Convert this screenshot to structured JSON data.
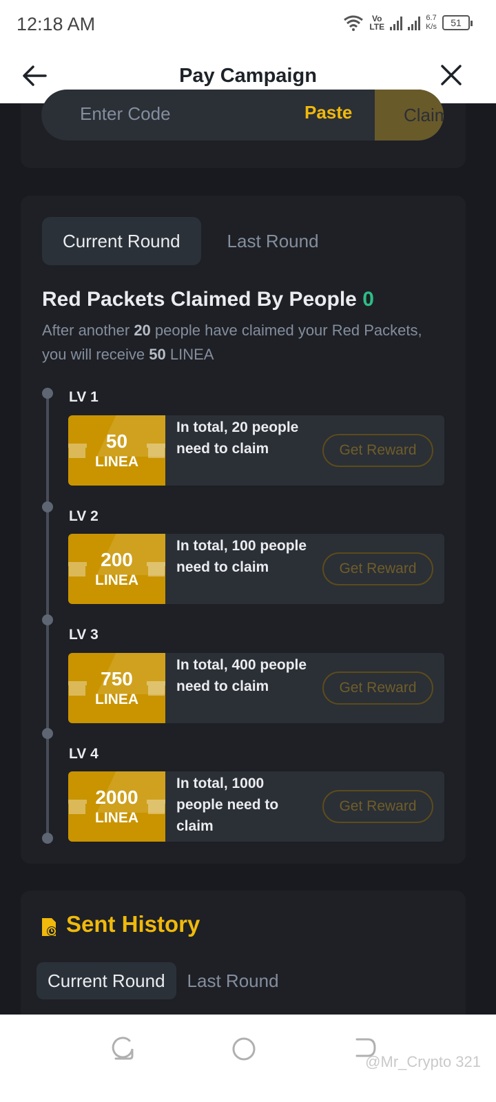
{
  "status_bar": {
    "time": "12:18 AM",
    "volte_top": "Vo",
    "volte_bottom": "LTE",
    "net_speed_value": "6.7",
    "net_speed_unit": "K/s",
    "battery": "51"
  },
  "header": {
    "title": "Pay Campaign",
    "back_icon": "arrow-left-icon",
    "close_icon": "close-icon"
  },
  "code_entry": {
    "placeholder": "Enter Code",
    "paste_label": "Paste",
    "claim_label": "Claim"
  },
  "round_tabs": [
    {
      "label": "Current Round",
      "active": true
    },
    {
      "label": "Last Round",
      "active": false
    }
  ],
  "red_packets": {
    "title": "Red Packets Claimed By People",
    "count": "0",
    "desc_pre": "After another ",
    "desc_people": "20",
    "desc_mid": " people have claimed your Red Packets, you will receive ",
    "desc_amount": "50",
    "desc_post": " LINEA"
  },
  "levels": [
    {
      "label": "LV 1",
      "amount": "50",
      "unit": "LINEA",
      "text": "In total, 20 people need to claim",
      "button": "Get Reward"
    },
    {
      "label": "LV 2",
      "amount": "200",
      "unit": "LINEA",
      "text": "In total, 100 people need to claim",
      "button": "Get Reward"
    },
    {
      "label": "LV 3",
      "amount": "750",
      "unit": "LINEA",
      "text": "In total, 400 people need to claim",
      "button": "Get Reward"
    },
    {
      "label": "LV 4",
      "amount": "2000",
      "unit": "LINEA",
      "text": "In total, 1000 people need to claim",
      "button": "Get Reward"
    }
  ],
  "sent_history": {
    "title": "Sent History",
    "tabs": [
      {
        "label": "Current Round",
        "active": true
      },
      {
        "label": "Last Round",
        "active": false
      }
    ]
  },
  "watermark": "@Mr_Crypto 321",
  "colors": {
    "accent": "#f0b90b",
    "success": "#2ebd85",
    "card_bg": "#1e2026",
    "page_bg": "#181a20"
  }
}
